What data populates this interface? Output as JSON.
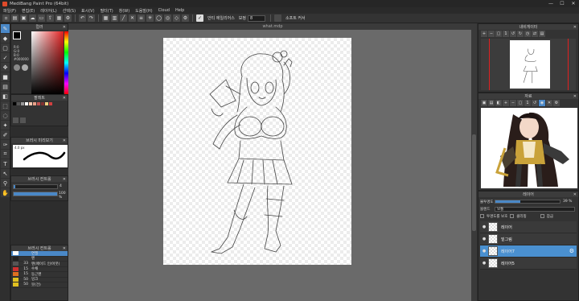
{
  "app": {
    "title": "MediBang Paint Pro (64bit)"
  },
  "window_controls": {
    "minimize": "—",
    "maximize": "☐",
    "close": "✕"
  },
  "menu": [
    "파일(F)",
    "편집(E)",
    "레이어(L)",
    "선택(S)",
    "표시(V)",
    "필터(T)",
    "창(W)",
    "도움말(H)",
    "Cloud",
    "Help"
  ],
  "toolbar": {
    "aa_label": "안티 에일리어스",
    "correction_label": "보정",
    "correction_value": "8",
    "soft_label": "소프트 커서"
  },
  "document": {
    "tab_name": "what.mdp"
  },
  "panels": {
    "color": {
      "title": "컬러",
      "readout": [
        "R:0",
        "G:0",
        "B:0",
        "#000000"
      ]
    },
    "palette": {
      "title": "팔레트"
    },
    "brush_preview": {
      "title": "브러시 미리보기",
      "size": "4.0 px"
    },
    "brush_control": {
      "title": "브러시 컨트롤",
      "size_value": "4",
      "opacity_value": "100 %"
    },
    "brush_list": {
      "title": "브러시 컨트롤",
      "rows": [
        {
          "num": "",
          "name": "연필",
          "selected": true
        },
        {
          "num": "",
          "name": "펜",
          "selected": false
        },
        {
          "num": "33",
          "name": "펜(페이드 인/아웃)",
          "selected": false
        },
        {
          "num": "15",
          "name": "수채",
          "selected": false
        },
        {
          "num": "15",
          "name": "둥근펜",
          "selected": false
        },
        {
          "num": "50",
          "name": "잉크",
          "selected": false
        },
        {
          "num": "50",
          "name": "붓(건)",
          "selected": false
        }
      ]
    },
    "navigator": {
      "title": "내비게이터"
    },
    "material": {
      "title": "자료"
    },
    "layer": {
      "title": "레이어",
      "opacity_label": "불투명도",
      "opacity_value": "39 %",
      "blend_label": "블렌드",
      "blend_value": "보통",
      "options": [
        "투명도를 보호",
        "클리핑",
        "잠금"
      ],
      "layers": [
        {
          "name": "레이어",
          "selected": false
        },
        {
          "name": "밑그림",
          "selected": false
        },
        {
          "name": "레이어7",
          "selected": true
        },
        {
          "name": "레이어5",
          "selected": false
        }
      ]
    }
  },
  "colors": {
    "accent": "#4a88c7",
    "canvas_bg": "#6a6a6a",
    "panel_bg": "#333333"
  }
}
